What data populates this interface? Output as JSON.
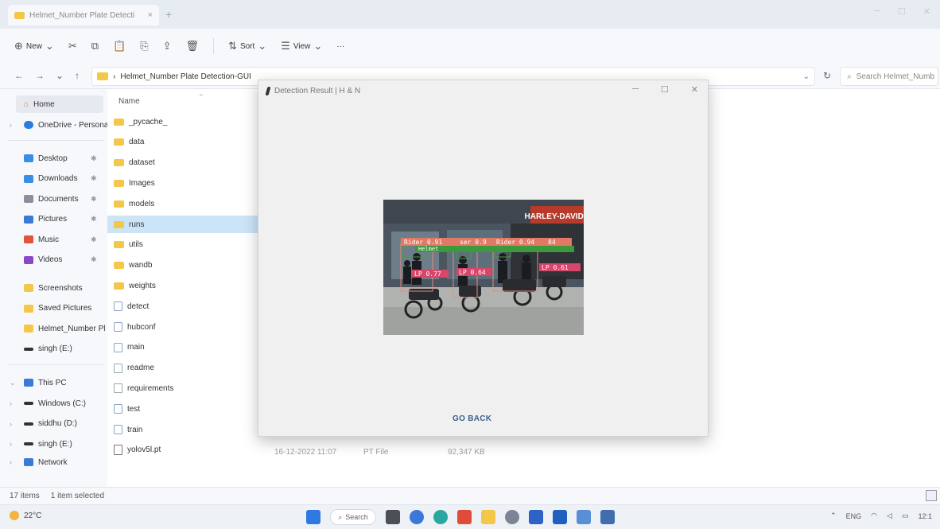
{
  "tab": {
    "title": "Helmet_Number Plate Detecti",
    "close": "×",
    "new": "+"
  },
  "toolbar": {
    "new_label": "New",
    "sort_label": "Sort",
    "view_label": "View",
    "more": "···"
  },
  "address": {
    "path": "Helmet_Number Plate Detection-GUI",
    "search_placeholder": "Search Helmet_Numb"
  },
  "sidebar": {
    "home": "Home",
    "onedrive": "OneDrive - Persona",
    "quick": [
      {
        "label": "Desktop",
        "color": "#3a8ee6"
      },
      {
        "label": "Downloads",
        "color": "#3a8ee6"
      },
      {
        "label": "Documents",
        "color": "#8a9099"
      },
      {
        "label": "Pictures",
        "color": "#3a7bd5"
      },
      {
        "label": "Music",
        "color": "#e0533d"
      },
      {
        "label": "Videos",
        "color": "#8b47c8"
      }
    ],
    "folders": [
      "Screenshots",
      "Saved Pictures",
      "Helmet_Number Pl",
      "singh (E:)"
    ],
    "this_pc": "This PC",
    "drives": [
      "Windows (C:)",
      "siddhu (D:)",
      "singh (E:)"
    ],
    "network": "Network"
  },
  "files": {
    "header": "Name",
    "rows": [
      {
        "name": "_pycache_",
        "type": "folder"
      },
      {
        "name": "data",
        "type": "folder"
      },
      {
        "name": "dataset",
        "type": "folder"
      },
      {
        "name": "Images",
        "type": "folder"
      },
      {
        "name": "models",
        "type": "folder"
      },
      {
        "name": "runs",
        "type": "folder",
        "selected": true
      },
      {
        "name": "utils",
        "type": "folder"
      },
      {
        "name": "wandb",
        "type": "folder"
      },
      {
        "name": "weights",
        "type": "folder"
      },
      {
        "name": "detect",
        "type": "py"
      },
      {
        "name": "hubconf",
        "type": "py"
      },
      {
        "name": "main",
        "type": "py"
      },
      {
        "name": "readme",
        "type": "txt"
      },
      {
        "name": "requirements",
        "type": "txt"
      },
      {
        "name": "test",
        "type": "py"
      },
      {
        "name": "train",
        "type": "py"
      },
      {
        "name": "yolov5l.pt",
        "type": "pt"
      }
    ],
    "last_detail": {
      "date": "16-12-2022 11:07",
      "type": "PT File",
      "size": "92,347 KB"
    }
  },
  "status": {
    "items": "17 items",
    "selected": "1 item selected"
  },
  "dialog": {
    "title": "Detection Result | H & N",
    "button": "GO BACK",
    "image_labels": {
      "sign": "HARLEY-DAVIDS",
      "riders": [
        "Rider 0.91",
        "ser 0.9",
        "Rider 0.94",
        "84"
      ],
      "helmet": "Helmet",
      "plates": [
        "LP 0.77",
        "LP 0.64",
        "LP 0.61"
      ]
    }
  },
  "taskbar": {
    "temp": "22°C",
    "search": "Search",
    "lang": "ENG",
    "time": "12:1"
  }
}
